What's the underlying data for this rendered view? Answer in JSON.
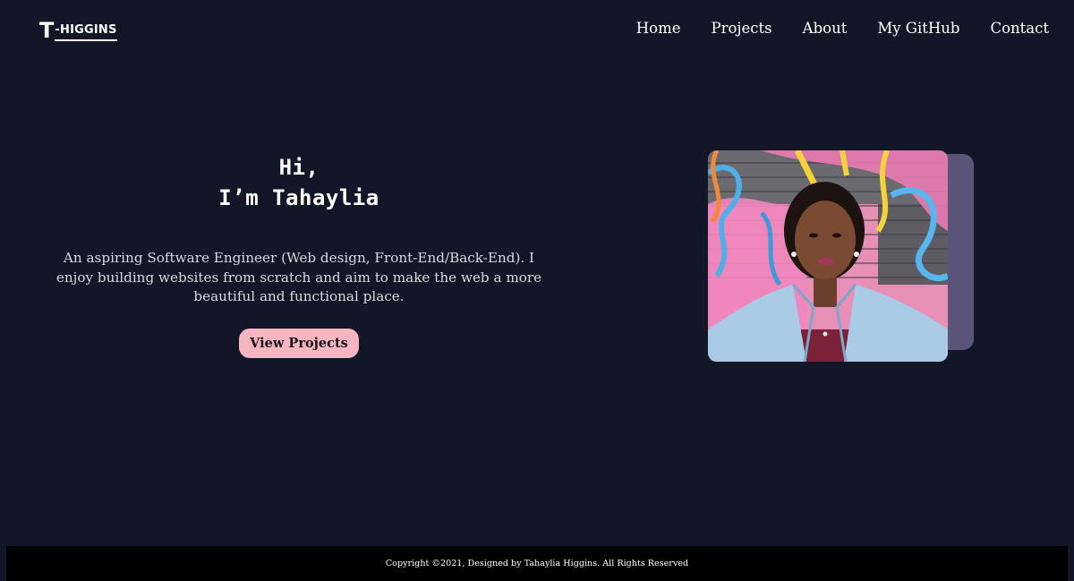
{
  "header": {
    "logo_initial": "T",
    "logo_dash": "-",
    "logo_name": "HIGGINS",
    "nav": [
      {
        "label": "Home"
      },
      {
        "label": "Projects"
      },
      {
        "label": "About"
      },
      {
        "label": "My GitHub"
      },
      {
        "label": "Contact"
      }
    ]
  },
  "hero": {
    "greeting_line1": "Hi,",
    "greeting_line2": "I’m Tahaylia",
    "intro": "An aspiring Software Engineer (Web design, Front-End/Back-End). I enjoy building websites from scratch and aim to make the web a more beautiful and functional place.",
    "cta_label": "View Projects"
  },
  "footer": {
    "copyright": "Copyright ©2021, Designed by Tahaylia Higgins. All Rights Reserved"
  },
  "colors": {
    "background": "#131626",
    "accent_button": "#f7b5c1",
    "portrait_backdrop": "#5a5478",
    "footer_bg": "#000000"
  }
}
